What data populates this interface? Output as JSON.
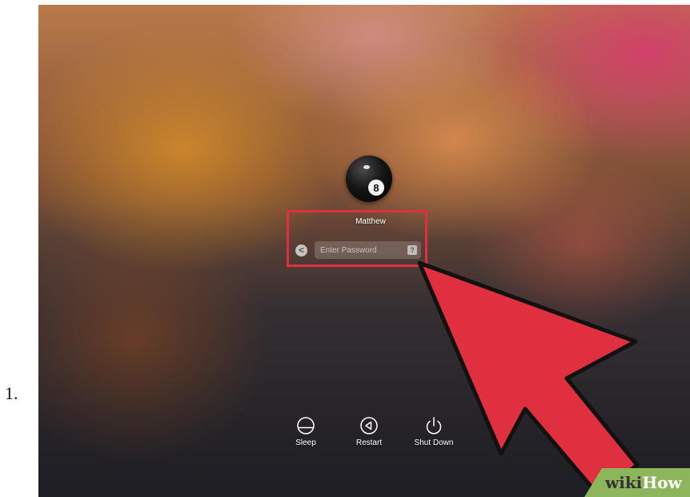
{
  "step_number": "1.",
  "login": {
    "user_name": "Matthew",
    "password_placeholder": "Enter Password",
    "back_glyph": "<",
    "hint_glyph": "?",
    "avatar_badge": "8"
  },
  "power_options": [
    {
      "label": "Sleep",
      "icon": "sleep-icon"
    },
    {
      "label": "Restart",
      "icon": "restart-icon"
    },
    {
      "label": "Shut Down",
      "icon": "shutdown-icon"
    }
  ],
  "annotation": {
    "highlight_color": "#e0303f",
    "arrow_color": "#e0303f"
  },
  "watermark": {
    "part1": "wiki",
    "part2": "How"
  }
}
